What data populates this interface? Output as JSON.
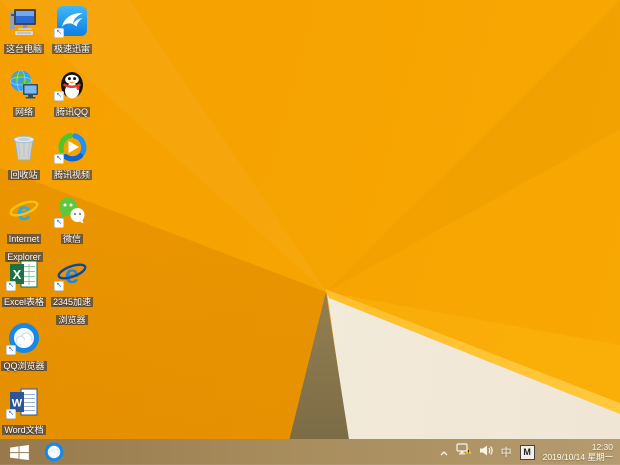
{
  "desktop": {
    "icons": [
      {
        "label": "这台电脑"
      },
      {
        "label": "极速迅雷"
      },
      {
        "label": "网络"
      },
      {
        "label": "腾讯QQ"
      },
      {
        "label": "回收站"
      },
      {
        "label": "腾讯视频"
      },
      {
        "label": "Internet Explorer"
      },
      {
        "label": "微信"
      },
      {
        "label": "Excel表格"
      },
      {
        "label": "2345加速浏览器"
      },
      {
        "label": "QQ浏览器"
      },
      {
        "label": "Word文档"
      }
    ],
    "shortcut_arrow": "↖"
  },
  "taskbar": {
    "tray": {
      "ime_mode": "中",
      "ime_badge": "M",
      "time": "12:30",
      "date": "2019/10/14 星期一"
    }
  },
  "colors": {
    "wallpaper_main": "#f7a402",
    "wallpaper_dark_facet": "#ee9900",
    "wallpaper_cream_facet": "#f4edda",
    "wallpaper_shadow_facet": "#8a7750",
    "ridge_highlight": "#ffc13d",
    "taskbar": "#a78c5c"
  }
}
